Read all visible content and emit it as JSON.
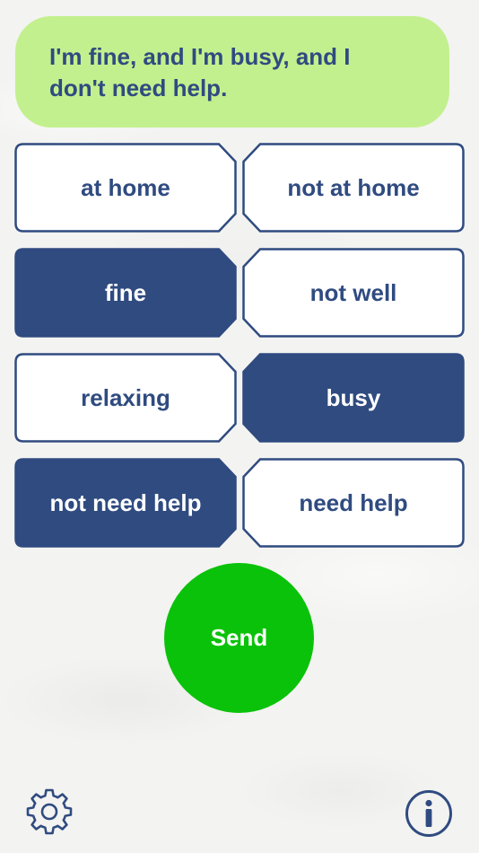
{
  "message": {
    "text": "I'm fine, and I'm busy, and I don't need help."
  },
  "options": [
    {
      "left": {
        "label": "at home",
        "selected": false
      },
      "right": {
        "label": "not at home",
        "selected": false
      }
    },
    {
      "left": {
        "label": "fine",
        "selected": true
      },
      "right": {
        "label": "not well",
        "selected": false
      }
    },
    {
      "left": {
        "label": "relaxing",
        "selected": false
      },
      "right": {
        "label": "busy",
        "selected": true
      }
    },
    {
      "left": {
        "label": "not need help",
        "selected": true
      },
      "right": {
        "label": "need help",
        "selected": false
      }
    }
  ],
  "send": {
    "label": "Send"
  },
  "icons": {
    "settings": "gear-icon",
    "info": "info-icon"
  },
  "colors": {
    "bubble": "#c3f08e",
    "text_navy": "#2f4b80",
    "selected_fill": "#2f4b80",
    "send_green": "#0ac20a"
  }
}
